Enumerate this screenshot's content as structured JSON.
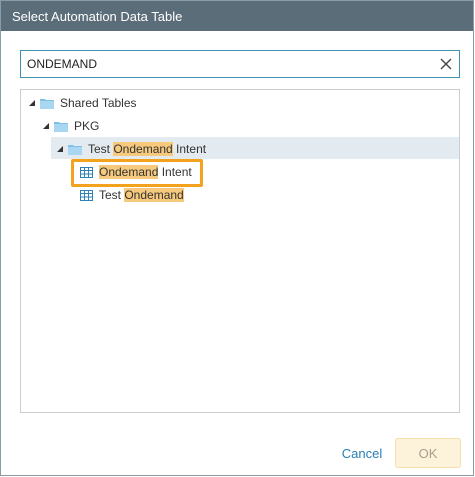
{
  "dialog": {
    "title": "Select Automation Data Table"
  },
  "search": {
    "value": "ONDEMAND"
  },
  "tree": {
    "root": {
      "label": "Shared Tables"
    },
    "pkg": {
      "label": "PKG"
    },
    "folder": {
      "prefix": "Test ",
      "match": "Ondemand",
      "suffix": " Intent"
    },
    "table1": {
      "prefix": "",
      "match": "Ondemand",
      "suffix": " Intent"
    },
    "table2": {
      "prefix": "Test ",
      "match": "Ondemand",
      "suffix": ""
    }
  },
  "footer": {
    "cancel_label": "Cancel",
    "ok_label": "OK"
  },
  "colors": {
    "titlebar": "#5b6d78",
    "match_highlight": "#f7c97c",
    "selection_border": "#f2a21c",
    "link": "#2a7db3"
  }
}
